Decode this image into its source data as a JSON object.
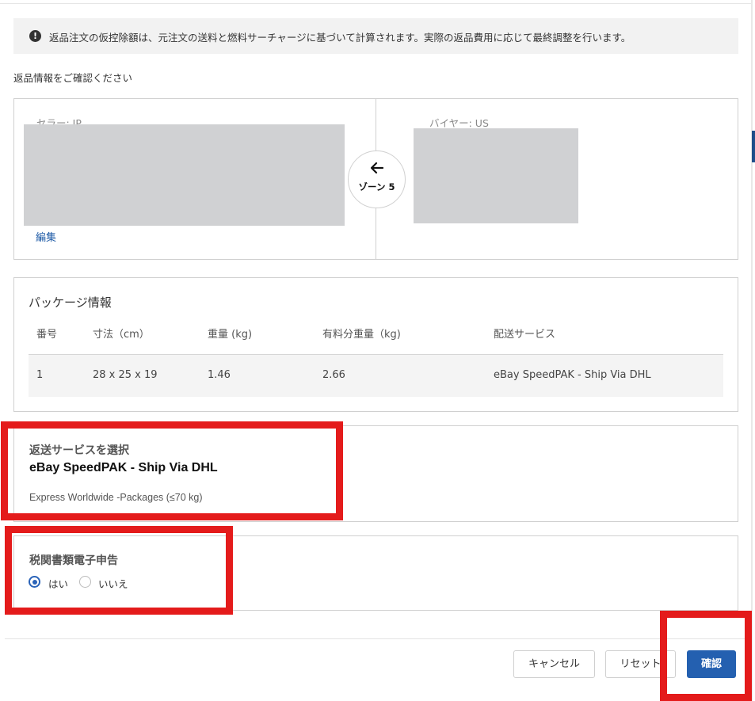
{
  "notice": {
    "icon": "info-exclamation-icon",
    "text": "返品注文の仮控除額は、元注文の送料と燃料サーチャージに基づいて計算されます。実際の返品費用に応じて最終調整を行います。"
  },
  "confirm_heading": "返品情報をご確認ください",
  "address": {
    "seller_label": "セラー: JP",
    "buyer_label": "バイヤー: US",
    "edit_link": "編集",
    "zone_arrow_icon": "arrow-left-icon",
    "zone_label": "ゾーン 5"
  },
  "package": {
    "title": "パッケージ情報",
    "columns": [
      "番号",
      "寸法（cm）",
      "重量 (kg)",
      "有料分重量（kg)",
      "配送サービス"
    ],
    "rows": [
      [
        "1",
        "28 x 25 x 19",
        "1.46",
        "2.66",
        "eBay SpeedPAK - Ship Via DHL"
      ]
    ]
  },
  "service": {
    "heading": "返送サービスを選択",
    "name": "eBay SpeedPAK - Ship Via DHL",
    "description": "Express Worldwide -Packages (≤70 kg)"
  },
  "customs": {
    "heading": "税関書類電子申告",
    "options": [
      {
        "label": "はい",
        "selected": true
      },
      {
        "label": "いいえ",
        "selected": false
      }
    ]
  },
  "footer": {
    "cancel_label": "キャンセル",
    "reset_label": "リセット",
    "confirm_label": "確認"
  },
  "colors": {
    "primary": "#2460b0",
    "link": "#1d5aa6",
    "highlight": "#e41b1b"
  }
}
